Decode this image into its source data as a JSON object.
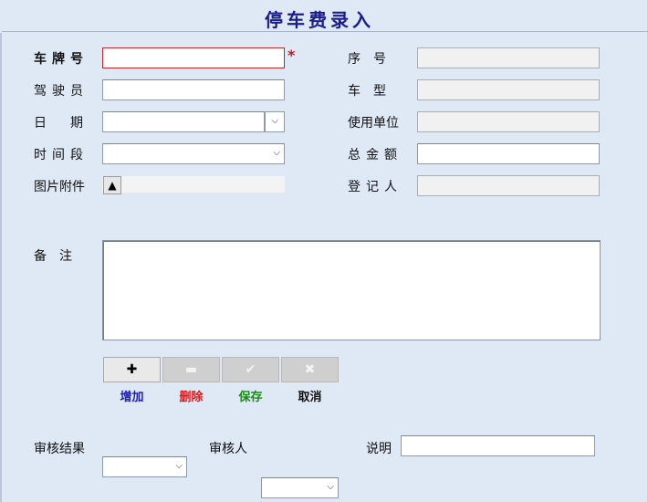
{
  "title": "停车费录入",
  "left": {
    "plate_label": "车牌号",
    "plate_value": "",
    "required_mark": "*",
    "driver_label": "驾驶员",
    "driver_value": "",
    "date_label": "日　期",
    "date_value": "",
    "period_label": "时间段",
    "period_value": "",
    "attach_label": "图片附件"
  },
  "right": {
    "seq_label": "序　号",
    "seq_value": "",
    "type_label": "车　型",
    "type_value": "",
    "unit_label": "使用单位",
    "unit_value": "",
    "total_label": "总金额",
    "total_value": "",
    "registrar_label": "登记人",
    "registrar_value": ""
  },
  "remark": {
    "label": "备　注",
    "value": ""
  },
  "toolbar": {
    "add_symbol": "✚",
    "delete_symbol": "▬",
    "save_symbol": "✔",
    "cancel_symbol": "✖",
    "add_label": "增加",
    "delete_label": "删除",
    "save_label": "保存",
    "cancel_label": "取消",
    "add_color": "#1d1db8",
    "delete_color": "#d31c1c",
    "save_color": "#1a8a1a",
    "cancel_color": "#111111"
  },
  "audit": {
    "result_label": "审核结果",
    "result_value": "",
    "auditor_label": "审核人",
    "auditor_value": "",
    "note_label": "说明",
    "note_value": ""
  },
  "icons": {
    "dropdown": "chevron-down-icon",
    "attach": "upload-triangle-icon"
  }
}
